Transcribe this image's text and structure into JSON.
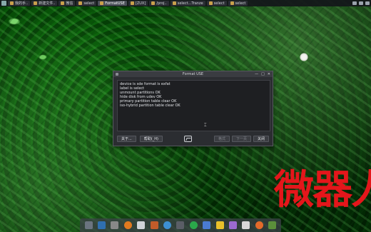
{
  "taskbar": {
    "tasks": [
      {
        "label": "我的手..",
        "active": false
      },
      {
        "label": "新建文件..",
        "active": false
      },
      {
        "label": "微信",
        "active": false
      },
      {
        "label": "select",
        "active": false
      },
      {
        "label": "FormatUSE",
        "active": true
      },
      {
        "label": "[ZUX]",
        "active": false
      },
      {
        "label": "/proj..",
        "active": false
      },
      {
        "label": "select...Tranze",
        "active": false
      },
      {
        "label": "select",
        "active": false
      },
      {
        "label": "select",
        "active": false
      }
    ]
  },
  "dialog": {
    "title": "Format USE",
    "window_buttons": [
      "—",
      "□",
      "✕"
    ],
    "log_lines": [
      "device is sde format is exfat",
      "label is select",
      "unmount partitions OK",
      "hide disk from udev OK",
      "primary partition table clear OK",
      "iso-hybrid partition table clear OK"
    ],
    "buttons": {
      "about": "关于...",
      "help": "帮助(_H)",
      "format": "格式",
      "next": "下一页",
      "close": "关闭"
    }
  },
  "watermark": "微器人",
  "colors": {
    "watermark": "#e4161b",
    "dialog_bg": "#2b2d31"
  }
}
